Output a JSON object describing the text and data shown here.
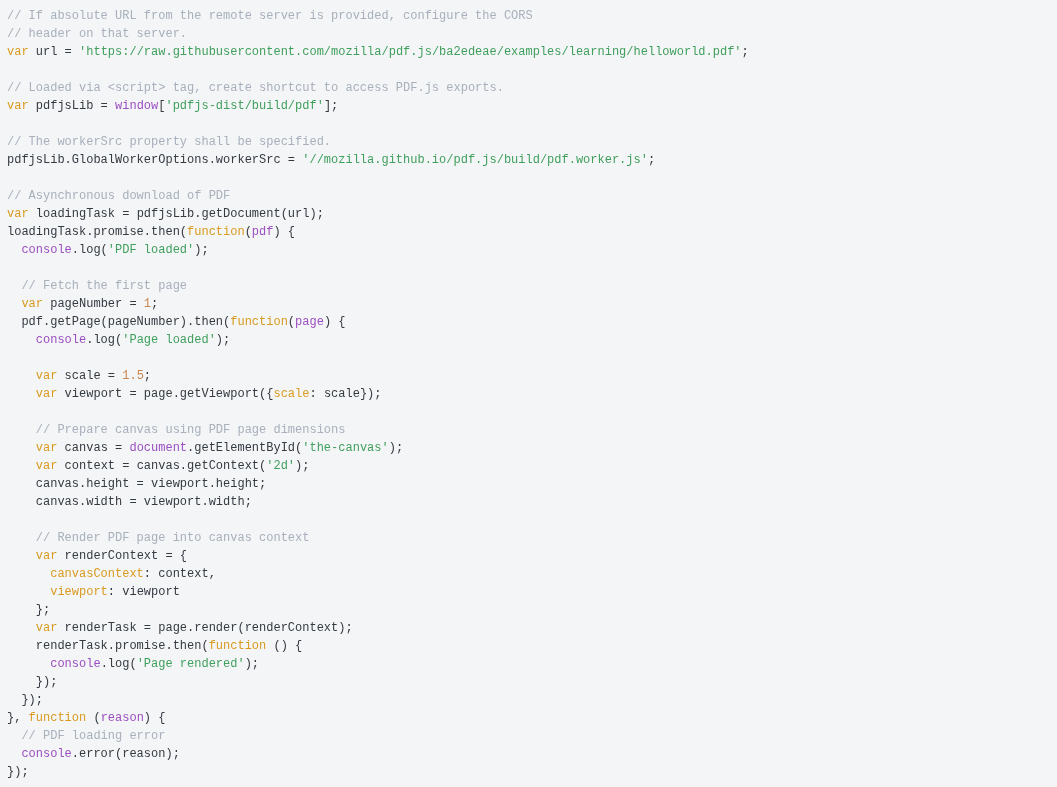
{
  "code_block": {
    "lines": [
      {
        "kind": "code",
        "tokens": [
          {
            "kind": "comment",
            "text": "// If absolute URL from the remote server is provided, configure the CORS"
          }
        ]
      },
      {
        "kind": "code",
        "tokens": [
          {
            "kind": "comment",
            "text": "// header on that server."
          }
        ]
      },
      {
        "kind": "code",
        "tokens": [
          {
            "kind": "keyword",
            "text": "var"
          },
          {
            "kind": "plain",
            "text": " url = "
          },
          {
            "kind": "string",
            "text": "'https://raw.githubusercontent.com/mozilla/pdf.js/ba2edeae/examples/learning/helloworld.pdf'"
          },
          {
            "kind": "plain",
            "text": ";"
          }
        ]
      },
      {
        "kind": "blank"
      },
      {
        "kind": "code",
        "tokens": [
          {
            "kind": "comment",
            "text": "// Loaded via <script> tag, create shortcut to access PDF.js exports."
          }
        ]
      },
      {
        "kind": "code",
        "tokens": [
          {
            "kind": "keyword",
            "text": "var"
          },
          {
            "kind": "plain",
            "text": " pdfjsLib = "
          },
          {
            "kind": "builtin",
            "text": "window"
          },
          {
            "kind": "plain",
            "text": "["
          },
          {
            "kind": "string",
            "text": "'pdfjs-dist/build/pdf'"
          },
          {
            "kind": "plain",
            "text": "];"
          }
        ]
      },
      {
        "kind": "blank"
      },
      {
        "kind": "code",
        "tokens": [
          {
            "kind": "comment",
            "text": "// The workerSrc property shall be specified."
          }
        ]
      },
      {
        "kind": "code",
        "tokens": [
          {
            "kind": "plain",
            "text": "pdfjsLib.GlobalWorkerOptions.workerSrc = "
          },
          {
            "kind": "string",
            "text": "'//mozilla.github.io/pdf.js/build/pdf.worker.js'"
          },
          {
            "kind": "plain",
            "text": ";"
          }
        ]
      },
      {
        "kind": "blank"
      },
      {
        "kind": "code",
        "tokens": [
          {
            "kind": "comment",
            "text": "// Asynchronous download of PDF"
          }
        ]
      },
      {
        "kind": "code",
        "tokens": [
          {
            "kind": "keyword",
            "text": "var"
          },
          {
            "kind": "plain",
            "text": " loadingTask = pdfjsLib.getDocument(url);"
          }
        ]
      },
      {
        "kind": "code",
        "tokens": [
          {
            "kind": "plain",
            "text": "loadingTask.promise.then("
          },
          {
            "kind": "keyword",
            "text": "function"
          },
          {
            "kind": "plain",
            "text": "("
          },
          {
            "kind": "builtin",
            "text": "pdf"
          },
          {
            "kind": "plain",
            "text": ") {"
          }
        ]
      },
      {
        "kind": "code",
        "tokens": [
          {
            "kind": "builtin",
            "text": "  console"
          },
          {
            "kind": "plain",
            "text": ".log("
          },
          {
            "kind": "string",
            "text": "'PDF loaded'"
          },
          {
            "kind": "plain",
            "text": ");"
          }
        ]
      },
      {
        "kind": "blank"
      },
      {
        "kind": "code",
        "tokens": [
          {
            "kind": "comment",
            "text": "  // Fetch the first page"
          }
        ]
      },
      {
        "kind": "code",
        "tokens": [
          {
            "kind": "keyword",
            "text": "  var"
          },
          {
            "kind": "plain",
            "text": " pageNumber = "
          },
          {
            "kind": "number",
            "text": "1"
          },
          {
            "kind": "plain",
            "text": ";"
          }
        ]
      },
      {
        "kind": "code",
        "tokens": [
          {
            "kind": "plain",
            "text": "  pdf.getPage(pageNumber).then("
          },
          {
            "kind": "keyword",
            "text": "function"
          },
          {
            "kind": "plain",
            "text": "("
          },
          {
            "kind": "builtin",
            "text": "page"
          },
          {
            "kind": "plain",
            "text": ") {"
          }
        ]
      },
      {
        "kind": "code",
        "tokens": [
          {
            "kind": "builtin",
            "text": "    console"
          },
          {
            "kind": "plain",
            "text": ".log("
          },
          {
            "kind": "string",
            "text": "'Page loaded'"
          },
          {
            "kind": "plain",
            "text": ");"
          }
        ]
      },
      {
        "kind": "blank"
      },
      {
        "kind": "code",
        "tokens": [
          {
            "kind": "keyword",
            "text": "    var"
          },
          {
            "kind": "plain",
            "text": " scale = "
          },
          {
            "kind": "number",
            "text": "1.5"
          },
          {
            "kind": "plain",
            "text": ";"
          }
        ]
      },
      {
        "kind": "code",
        "tokens": [
          {
            "kind": "keyword",
            "text": "    var"
          },
          {
            "kind": "plain",
            "text": " viewport = page.getViewport({"
          },
          {
            "kind": "property",
            "text": "scale"
          },
          {
            "kind": "plain",
            "text": ": scale});"
          }
        ]
      },
      {
        "kind": "blank"
      },
      {
        "kind": "code",
        "tokens": [
          {
            "kind": "comment",
            "text": "    // Prepare canvas using PDF page dimensions"
          }
        ]
      },
      {
        "kind": "code",
        "tokens": [
          {
            "kind": "keyword",
            "text": "    var"
          },
          {
            "kind": "plain",
            "text": " canvas = "
          },
          {
            "kind": "builtin",
            "text": "document"
          },
          {
            "kind": "plain",
            "text": ".getElementById("
          },
          {
            "kind": "string",
            "text": "'the-canvas'"
          },
          {
            "kind": "plain",
            "text": ");"
          }
        ]
      },
      {
        "kind": "code",
        "tokens": [
          {
            "kind": "keyword",
            "text": "    var"
          },
          {
            "kind": "plain",
            "text": " context = canvas.getContext("
          },
          {
            "kind": "string",
            "text": "'2d'"
          },
          {
            "kind": "plain",
            "text": ");"
          }
        ]
      },
      {
        "kind": "code",
        "tokens": [
          {
            "kind": "plain",
            "text": "    canvas.height = viewport.height;"
          }
        ]
      },
      {
        "kind": "code",
        "tokens": [
          {
            "kind": "plain",
            "text": "    canvas.width = viewport.width;"
          }
        ]
      },
      {
        "kind": "blank"
      },
      {
        "kind": "code",
        "tokens": [
          {
            "kind": "comment",
            "text": "    // Render PDF page into canvas context"
          }
        ]
      },
      {
        "kind": "code",
        "tokens": [
          {
            "kind": "keyword",
            "text": "    var"
          },
          {
            "kind": "plain",
            "text": " renderContext = {"
          }
        ]
      },
      {
        "kind": "code",
        "tokens": [
          {
            "kind": "property",
            "text": "      canvasContext"
          },
          {
            "kind": "plain",
            "text": ": context,"
          }
        ]
      },
      {
        "kind": "code",
        "tokens": [
          {
            "kind": "property",
            "text": "      viewport"
          },
          {
            "kind": "plain",
            "text": ": viewport"
          }
        ]
      },
      {
        "kind": "code",
        "tokens": [
          {
            "kind": "plain",
            "text": "    };"
          }
        ]
      },
      {
        "kind": "code",
        "tokens": [
          {
            "kind": "keyword",
            "text": "    var"
          },
          {
            "kind": "plain",
            "text": " renderTask = page.render(renderContext);"
          }
        ]
      },
      {
        "kind": "code",
        "tokens": [
          {
            "kind": "plain",
            "text": "    renderTask.promise.then("
          },
          {
            "kind": "keyword",
            "text": "function"
          },
          {
            "kind": "plain",
            "text": " () {"
          }
        ]
      },
      {
        "kind": "code",
        "tokens": [
          {
            "kind": "builtin",
            "text": "      console"
          },
          {
            "kind": "plain",
            "text": ".log("
          },
          {
            "kind": "string",
            "text": "'Page rendered'"
          },
          {
            "kind": "plain",
            "text": ");"
          }
        ]
      },
      {
        "kind": "code",
        "tokens": [
          {
            "kind": "plain",
            "text": "    });"
          }
        ]
      },
      {
        "kind": "code",
        "tokens": [
          {
            "kind": "plain",
            "text": "  });"
          }
        ]
      },
      {
        "kind": "code",
        "tokens": [
          {
            "kind": "plain",
            "text": "}, "
          },
          {
            "kind": "keyword",
            "text": "function"
          },
          {
            "kind": "plain",
            "text": " ("
          },
          {
            "kind": "builtin",
            "text": "reason"
          },
          {
            "kind": "plain",
            "text": ") {"
          }
        ]
      },
      {
        "kind": "code",
        "tokens": [
          {
            "kind": "comment",
            "text": "  // PDF loading error"
          }
        ]
      },
      {
        "kind": "code",
        "tokens": [
          {
            "kind": "builtin",
            "text": "  console"
          },
          {
            "kind": "plain",
            "text": ".error(reason);"
          }
        ]
      },
      {
        "kind": "code",
        "tokens": [
          {
            "kind": "plain",
            "text": "});"
          }
        ]
      }
    ]
  }
}
